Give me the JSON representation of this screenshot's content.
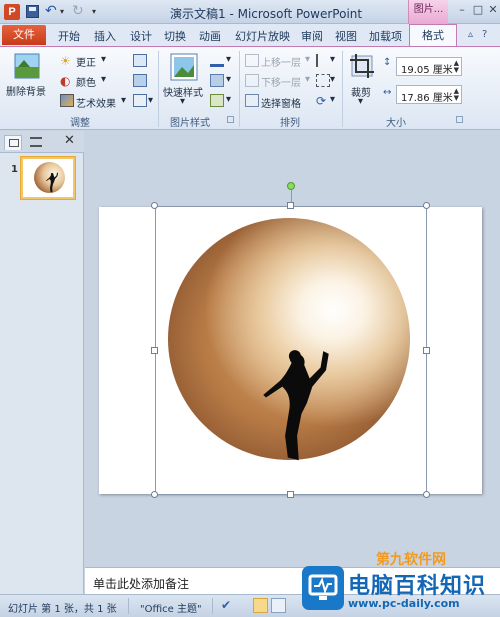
{
  "window": {
    "title": "演示文稿1 - Microsoft PowerPoint",
    "context_group": "图片...",
    "app_icon_letter": "P"
  },
  "tabs": {
    "file": "文件",
    "items": [
      "开始",
      "插入",
      "设计",
      "切换",
      "动画",
      "幻灯片放映",
      "审阅",
      "视图",
      "加载项"
    ],
    "active": "格式"
  },
  "ribbon": {
    "adjust": {
      "remove_bg": "删除背景",
      "correct": "更正",
      "color": "颜色",
      "art_effects": "艺术效果",
      "label": "调整"
    },
    "picture_styles": {
      "quick_styles": "快速样式",
      "label": "图片样式"
    },
    "arrange": {
      "bring_forward": "上移一层",
      "send_backward": "下移一层",
      "selection_pane": "选择窗格",
      "label": "排列"
    },
    "size": {
      "crop": "裁剪",
      "height": "19.05 厘米",
      "width": "17.86 厘米",
      "label": "大小"
    }
  },
  "left_pane": {
    "slide_number": "1",
    "close": "✕"
  },
  "notes": {
    "placeholder": "单击此处添加备注"
  },
  "statusbar": {
    "slide_info": "幻灯片 第 1 张，共 1 张",
    "theme": "\"Office 主题\""
  },
  "watermark": {
    "brand_small": "第九软件网",
    "brand_big": "电脑百科知识",
    "url": "www.pc-daily.com"
  }
}
